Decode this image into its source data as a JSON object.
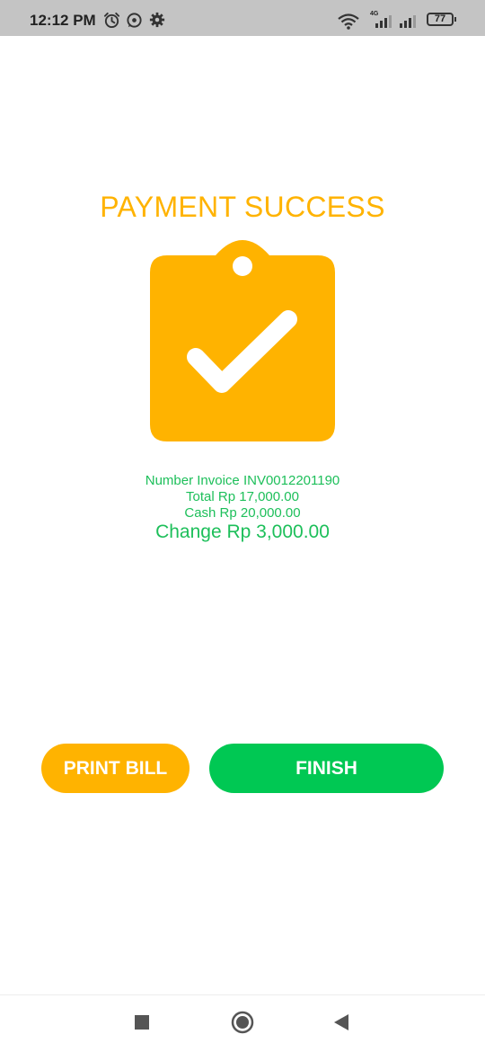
{
  "status_bar": {
    "time": "12:12 PM",
    "icons": [
      "alarm-icon",
      "whatsapp-icon",
      "settings-icon",
      "wifi-icon",
      "signal-4g-icon",
      "signal-icon",
      "battery-icon"
    ],
    "network_label": "4G",
    "battery_level": "77"
  },
  "page": {
    "title": "PAYMENT SUCCESS",
    "icon": "clipboard-check-icon",
    "accent_color": "#ffb300",
    "success_color": "#1dbf5a"
  },
  "invoice": {
    "number_line": "Number Invoice INV0012201190",
    "total_line": "Total Rp 17,000.00",
    "cash_line": "Cash Rp 20,000.00",
    "change_line": "Change Rp 3,000.00"
  },
  "actions": {
    "print_label": "PRINT BILL",
    "print_color": "#ffb300",
    "finish_label": "FINISH",
    "finish_color": "#00c853"
  },
  "navigation": {
    "icons": [
      "recent-apps-icon",
      "home-icon",
      "back-icon"
    ]
  }
}
